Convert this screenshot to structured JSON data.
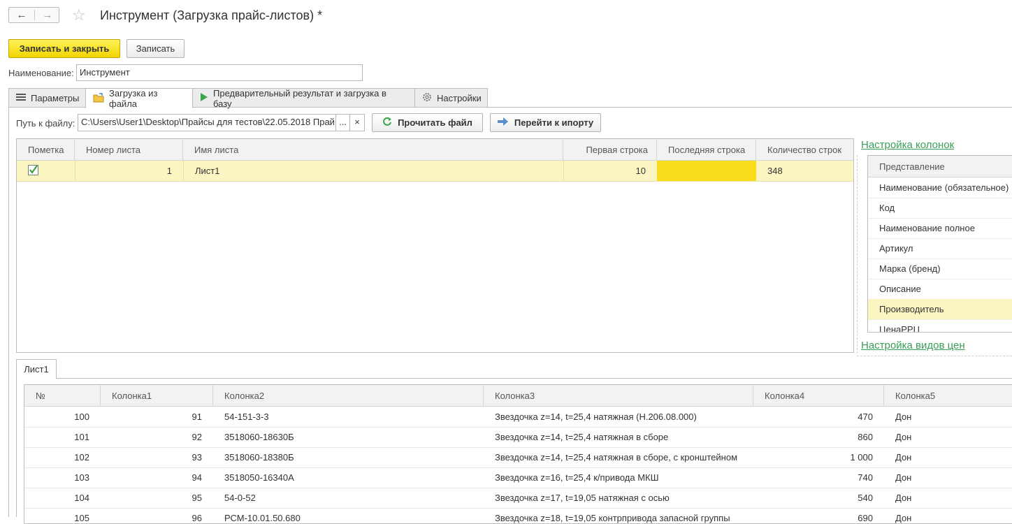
{
  "window": {
    "title": "Инструмент (Загрузка прайс-листов) *",
    "back_icon": "←",
    "forward_icon": "→",
    "favorite_icon": "☆"
  },
  "toolbar": {
    "save_close_label": "Записать и закрыть",
    "save_label": "Записать"
  },
  "name_field": {
    "label": "Наименование:",
    "value": "Инструмент"
  },
  "tabs": [
    {
      "label": "Параметры",
      "icon": "list-icon"
    },
    {
      "label": "Загрузка из файла",
      "icon": "folder-icon"
    },
    {
      "label": "Предварительный результат и загрузка в базу",
      "icon": "play-icon"
    },
    {
      "label": "Настройки",
      "icon": "gear-icon"
    }
  ],
  "file": {
    "label": "Путь к файлу:",
    "value": "C:\\Users\\User1\\Desktop\\Прайсы для тестов\\22.05.2018 Прай",
    "browse": "...",
    "clear": "×",
    "read_label": "Прочитать файл",
    "goto_label": "Перейти к ипорту"
  },
  "sheets_table": {
    "columns": [
      "Пометка",
      "Номер листа",
      "Имя листа",
      "Первая строка",
      "Последняя строка",
      "Количество строк"
    ],
    "rows": [
      {
        "checked": true,
        "number": "1",
        "name": "Лист1",
        "first_row": "10",
        "last_row": "",
        "count": "348"
      }
    ]
  },
  "columns_settings": {
    "link": "Настройка колонок",
    "header": "Представление",
    "items": [
      "Наименование (обязательное)",
      "Код",
      "Наименование полное",
      "Артикул",
      "Марка (бренд)",
      "Описание",
      "Производитель",
      "ЦенаРРЦ"
    ],
    "selected_index": 6
  },
  "price_types_link": "Настройка видов цен",
  "sheet_tab": "Лист1",
  "data_table": {
    "columns": [
      "№",
      "Колонка1",
      "Колонка2",
      "Колонка3",
      "Колонка4",
      "Колонка5"
    ],
    "rows": [
      [
        "100",
        "91",
        "54-151-3-3",
        "Звездочка z=14, t=25,4 натяжная (Н.206.08.000)",
        "470",
        "Дон"
      ],
      [
        "101",
        "92",
        "3518060-18630Б",
        "Звездочка z=14, t=25,4 натяжная в сборе",
        "860",
        "Дон"
      ],
      [
        "102",
        "93",
        "3518060-18380Б",
        "Звездочка z=14, t=25,4 натяжная в сборе, с кронштейном",
        "1 000",
        "Дон"
      ],
      [
        "103",
        "94",
        "3518050-16340А",
        "Звездочка z=16, t=25,4 к/привода МКШ",
        "740",
        "Дон"
      ],
      [
        "104",
        "95",
        "54-0-52",
        "Звездочка z=17, t=19,05 натяжная с осью",
        "540",
        "Дон"
      ],
      [
        "105",
        "96",
        "РСМ-10.01.50.680",
        "Звездочка z=18, t=19,05 контрпривода запасной группы",
        "690",
        "Дон"
      ]
    ]
  },
  "colors": {
    "accent_yellow": "#f9dc1c",
    "row_highlight": "#fbf5c2",
    "link_green": "#3a9e56"
  }
}
